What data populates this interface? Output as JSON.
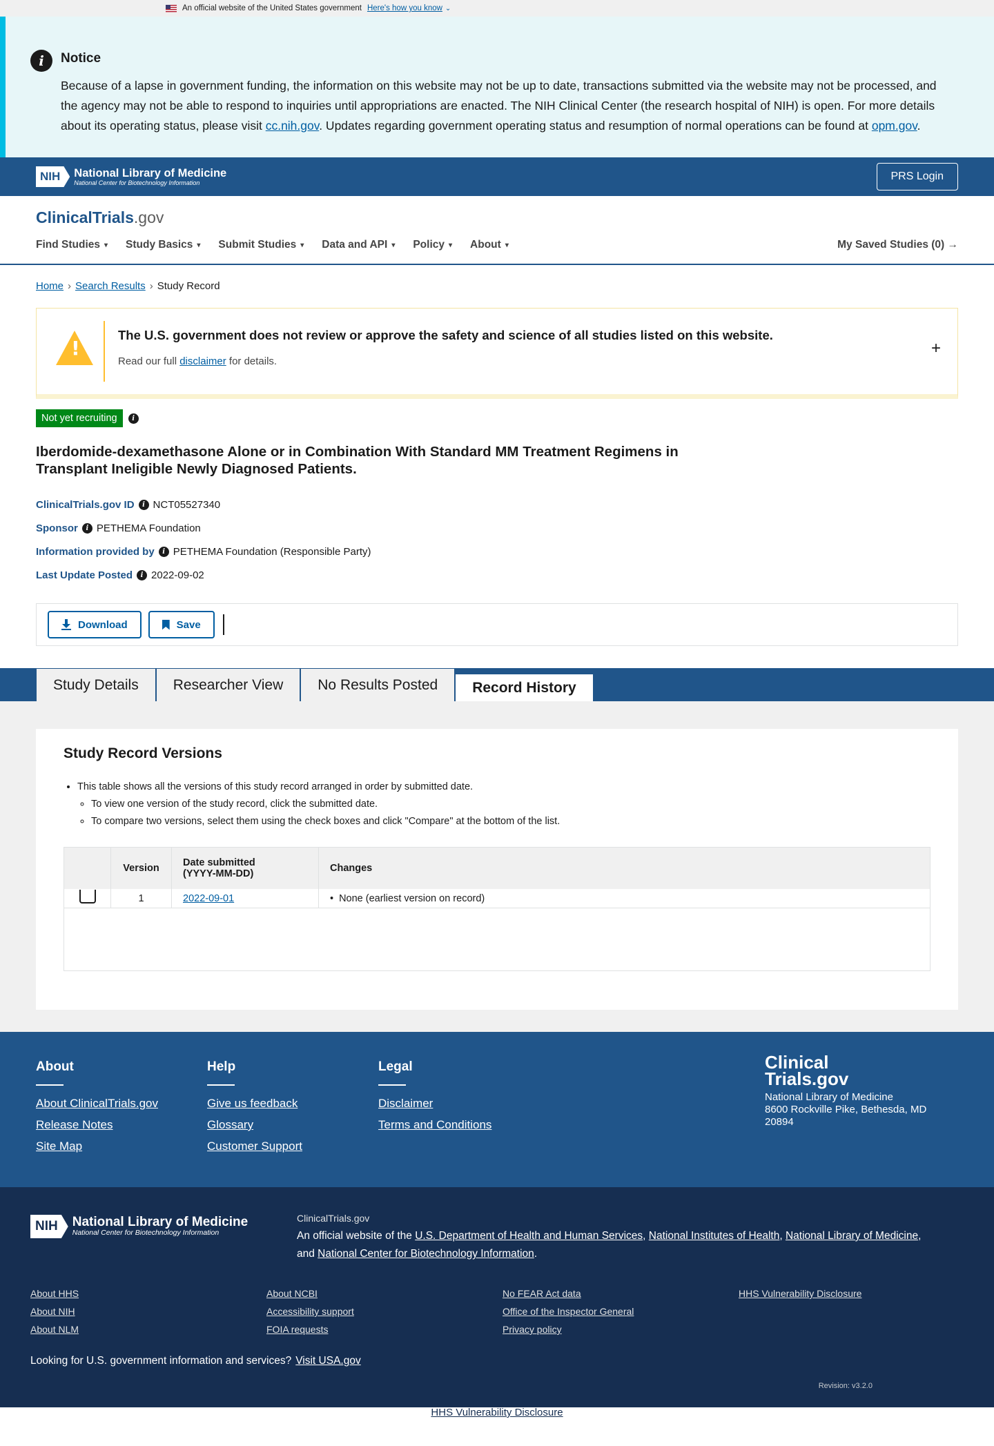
{
  "gov_banner": {
    "text": "An official website of the United States government",
    "how_label": "Here's how you know"
  },
  "notice": {
    "title": "Notice",
    "p1": "Because of a lapse in government funding, the information on this website may not be up to date, transactions submitted via the website may not be processed, and the agency may not be able to respond to inquiries until appropriations are enacted. The NIH Clinical Center (the research hospital of NIH) is open. For more details about its operating status, please visit ",
    "link1": "cc.nih.gov",
    "p2": ". Updates regarding government operating status and resumption of normal operations can be found at ",
    "link2": "opm.gov",
    "p3": "."
  },
  "nih_header": {
    "mark": "NIH",
    "name": "National Library of Medicine",
    "sub": "National Center for Biotechnology Information",
    "prs_login": "PRS Login"
  },
  "site": {
    "logo_main": "ClinicalTrials",
    "logo_gov": ".gov",
    "nav": [
      "Find Studies",
      "Study Basics",
      "Submit Studies",
      "Data and API",
      "Policy",
      "About"
    ],
    "saved": "My Saved Studies (0)"
  },
  "breadcrumb": {
    "home": "Home",
    "search": "Search Results",
    "current": "Study Record"
  },
  "disclaimer": {
    "title": "The U.S. government does not review or approve the safety and science of all studies listed on this website.",
    "pre": "Read our full ",
    "link": "disclaimer",
    "post": " for details.",
    "expand": "+"
  },
  "study": {
    "status": "Not yet recruiting",
    "title": "Iberdomide-dexamethasone Alone or in Combination With Standard MM Treatment Regimens in Transplant Ineligible Newly Diagnosed Patients.",
    "meta": [
      {
        "label": "ClinicalTrials.gov ID",
        "value": "NCT05527340"
      },
      {
        "label": "Sponsor",
        "value": "PETHEMA Foundation"
      },
      {
        "label": "Information provided by",
        "value": "PETHEMA Foundation (Responsible Party)"
      },
      {
        "label": "Last Update Posted",
        "value": "2022-09-02"
      }
    ]
  },
  "actions": {
    "download": "Download",
    "save": "Save"
  },
  "tabs": [
    "Study Details",
    "Researcher View",
    "No Results Posted",
    "Record History"
  ],
  "versions": {
    "title": "Study Record Versions",
    "bullet1": "This table shows all the versions of this study record arranged in order by submitted date.",
    "sub1": "To view one version of the study record, click the submitted date.",
    "sub2": "To compare two versions, select them using the check boxes and click \"Compare\" at the bottom of the list.",
    "headers": {
      "version": "Version",
      "date_line1": "Date submitted",
      "date_line2": "(YYYY-MM-DD)",
      "changes": "Changes"
    },
    "rows": [
      {
        "version": "1",
        "date": "2022-09-01",
        "changes": "None (earliest version on record)"
      }
    ]
  },
  "footer": {
    "about": {
      "title": "About",
      "links": [
        "About ClinicalTrials.gov",
        "Release Notes",
        "Site Map"
      ]
    },
    "help": {
      "title": "Help",
      "links": [
        "Give us feedback",
        "Glossary",
        "Customer Support"
      ]
    },
    "legal": {
      "title": "Legal",
      "links": [
        "Disclaimer",
        "Terms and Conditions"
      ]
    },
    "logo_line1": "Clinical",
    "logo_line2": "Trials.gov",
    "address1": "National Library of Medicine",
    "address2": "8600 Rockville Pike, Bethesda, MD",
    "address3": "20894"
  },
  "footer_bottom": {
    "site": "ClinicalTrials.gov",
    "official_pre": "An official website of the ",
    "hhs": "U.S. Department of Health and Human Services",
    "nih": "National Institutes of Health",
    "nlm": "National Library of Medicine",
    "and": "and ",
    "ncbi": "National Center for Biotechnology Information",
    "col1": [
      "About HHS",
      "About NIH",
      "About NLM"
    ],
    "col2": [
      "About NCBI",
      "Accessibility support",
      "FOIA requests"
    ],
    "col3": [
      "No FEAR Act data",
      "Office of the Inspector General",
      "Privacy policy"
    ],
    "col4": [
      "HHS Vulnerability Disclosure"
    ],
    "usa_pre": "Looking for U.S. government information and services?",
    "usa_link": "Visit USA.gov",
    "revision": "Revision: v3.2.0"
  },
  "final_link": "HHS Vulnerability Disclosure"
}
